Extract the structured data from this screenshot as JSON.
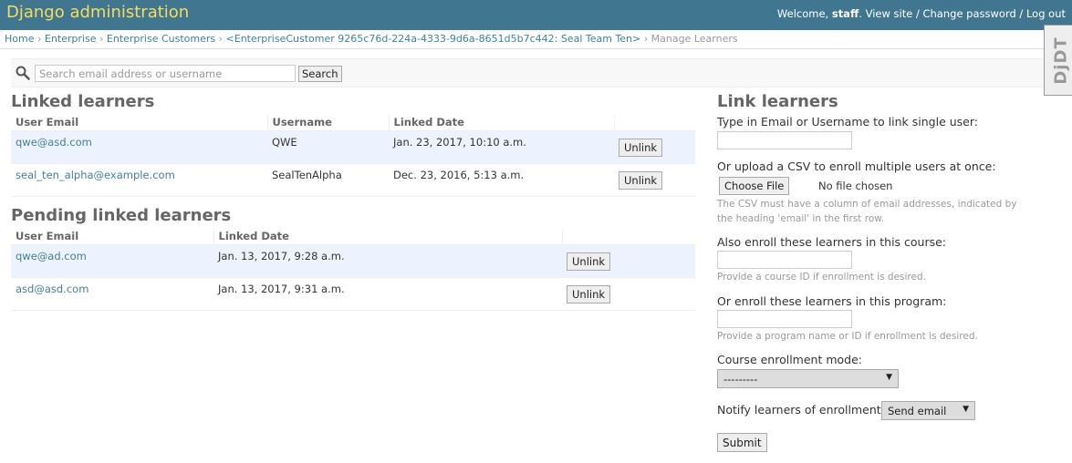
{
  "header": {
    "branding": "Django administration",
    "welcome": "Welcome, ",
    "username": "staff",
    "view_site": "View site",
    "change_password": "Change password",
    "log_out": "Log out",
    "sep1": ". ",
    "sep2": " / ",
    "sep3": " / "
  },
  "breadcrumbs": {
    "home": "Home",
    "enterprise": "Enterprise",
    "enterprise_customers": "Enterprise Customers",
    "customer": "<EnterpriseCustomer 9265c76d-224a-4333-9d6a-8651d5b7c442: Seal Team Ten>",
    "current": "Manage Learners",
    "sep": " › "
  },
  "search": {
    "placeholder": "Search email address or username",
    "button": "Search",
    "icon": "search-icon"
  },
  "linked": {
    "title": "Linked learners",
    "columns": [
      "User Email",
      "Username",
      "Linked Date"
    ],
    "rows": [
      {
        "email": "qwe@asd.com",
        "username": "QWE",
        "date": "Jan. 23, 2017, 10:10 a.m.",
        "action": "Unlink"
      },
      {
        "email": "seal_ten_alpha@example.com",
        "username": "SealTenAlpha",
        "date": "Dec. 23, 2016, 5:13 a.m.",
        "action": "Unlink"
      }
    ]
  },
  "pending": {
    "title": "Pending linked learners",
    "columns": [
      "User Email",
      "Linked Date"
    ],
    "rows": [
      {
        "email": "qwe@ad.com",
        "date": "Jan. 13, 2017, 9:28 a.m.",
        "action": "Unlink"
      },
      {
        "email": "asd@asd.com",
        "date": "Jan. 13, 2017, 9:31 a.m.",
        "action": "Unlink"
      }
    ]
  },
  "link_form": {
    "title": "Link learners",
    "single_label": "Type in Email or Username to link single user:",
    "csv_label": "Or upload a CSV to enroll multiple users at once:",
    "choose_file": "Choose File",
    "no_file": "No file chosen",
    "csv_help": "The CSV must have a column of email addresses, indicated by the heading 'email' in the first row.",
    "course_label": "Also enroll these learners in this course:",
    "course_help": "Provide a course ID if enrollment is desired.",
    "program_label": "Or enroll these learners in this program:",
    "program_help": "Provide a program name or ID if enrollment is desired.",
    "mode_label": "Course enrollment mode:",
    "mode_value": "---------",
    "notify_label": "Notify learners of enrollment:",
    "notify_value": "Send email",
    "submit": "Submit"
  },
  "debug_toolbar": {
    "label": "DjDT"
  }
}
